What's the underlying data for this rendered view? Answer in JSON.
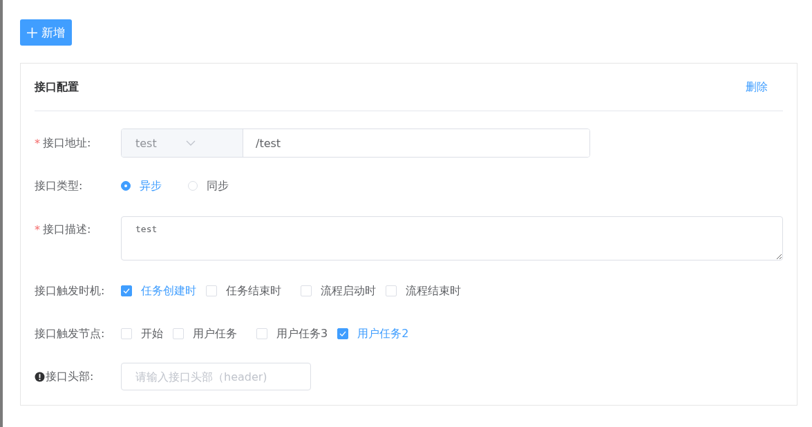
{
  "add_button": {
    "label": "新增"
  },
  "card": {
    "title": "接口配置",
    "delete_link": "删除"
  },
  "fields": [
    {
      "kind": "address",
      "label": "接口地址:",
      "required_mark": "*",
      "select_value": "test",
      "value": "/test"
    },
    {
      "kind": "radio",
      "label": "接口类型:",
      "options": [
        {
          "label": "异步",
          "selected": true
        },
        {
          "label": "同步",
          "selected": false
        }
      ]
    },
    {
      "kind": "textarea",
      "label": "接口描述:",
      "required_mark": "*",
      "value": "test"
    },
    {
      "kind": "checkbox",
      "label": "接口触发时机:",
      "options": [
        {
          "label": "任务创建时",
          "checked": true
        },
        {
          "label": "任务结束时",
          "checked": false
        },
        {
          "label": "流程启动时",
          "checked": false
        },
        {
          "label": "流程结束时",
          "checked": false
        }
      ]
    },
    {
      "kind": "checkbox",
      "label": "接口触发节点:",
      "options": [
        {
          "label": "开始",
          "checked": false
        },
        {
          "label": "用户任务",
          "checked": false
        },
        {
          "label": "用户任务3",
          "checked": false
        },
        {
          "label": "用户任务2",
          "checked": true
        }
      ]
    },
    {
      "kind": "input",
      "label": "接口头部:",
      "info": true,
      "placeholder": "请输入接口头部（header)"
    }
  ]
}
